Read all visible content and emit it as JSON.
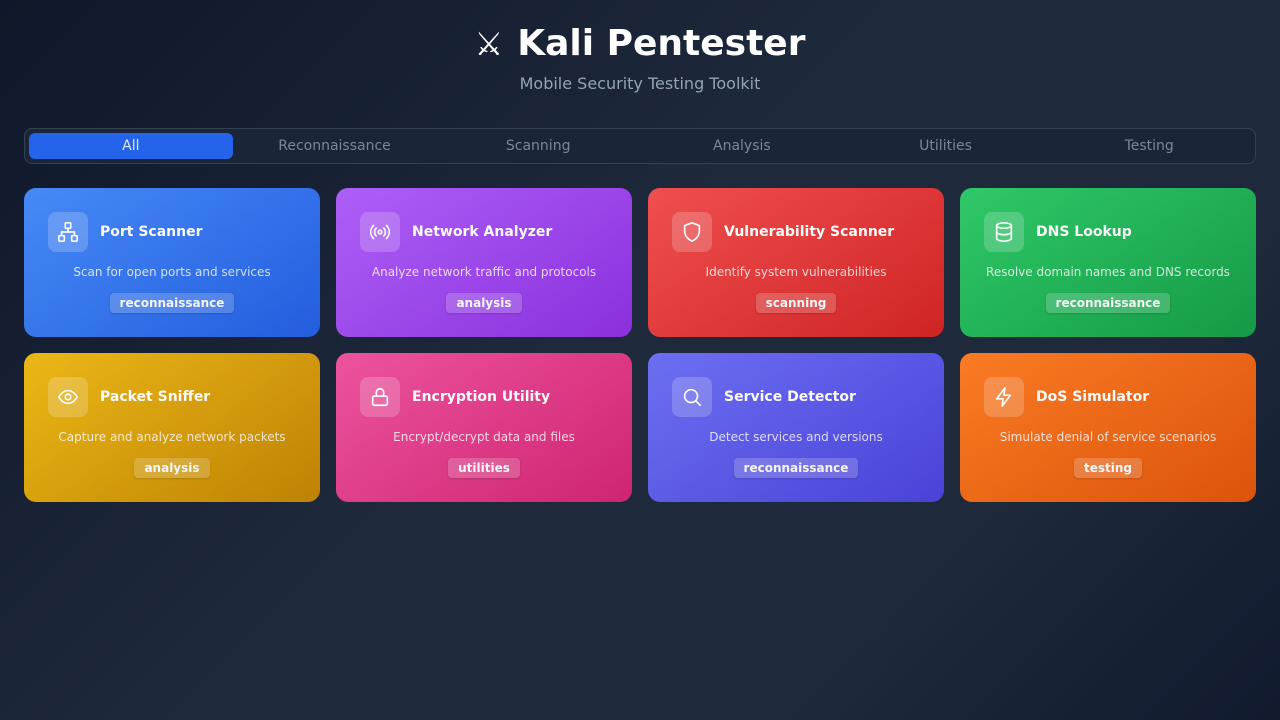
{
  "header": {
    "icon": "⚔",
    "title": "Kali Pentester",
    "subtitle": "Mobile Security Testing Toolkit"
  },
  "tabs": [
    {
      "label": "All",
      "active": true
    },
    {
      "label": "Reconnaissance",
      "active": false
    },
    {
      "label": "Scanning",
      "active": false
    },
    {
      "label": "Analysis",
      "active": false
    },
    {
      "label": "Utilities",
      "active": false
    },
    {
      "label": "Testing",
      "active": false
    }
  ],
  "colors": {
    "accent": "#2563eb",
    "blue": [
      "#3b82f6",
      "#2563eb"
    ],
    "purple": [
      "#a855f7",
      "#9333ea"
    ],
    "red": [
      "#ef4444",
      "#dc2626"
    ],
    "green": [
      "#22c55e",
      "#16a34a"
    ],
    "yellow": [
      "#eab308",
      "#ca8a04"
    ],
    "pink": [
      "#ec4899",
      "#db2777"
    ],
    "indigo": [
      "#6366f1",
      "#4f46e5"
    ],
    "orange": [
      "#f97316",
      "#ea580c"
    ]
  },
  "tools": [
    {
      "name": "Port Scanner",
      "description": "Scan for open ports and services",
      "category": "reconnaissance",
      "icon": "network-icon",
      "color": "blue"
    },
    {
      "name": "Network Analyzer",
      "description": "Analyze network traffic and protocols",
      "category": "analysis",
      "icon": "broadcast-icon",
      "color": "purple"
    },
    {
      "name": "Vulnerability Scanner",
      "description": "Identify system vulnerabilities",
      "category": "scanning",
      "icon": "shield-icon",
      "color": "red"
    },
    {
      "name": "DNS Lookup",
      "description": "Resolve domain names and DNS records",
      "category": "reconnaissance",
      "icon": "database-icon",
      "color": "green"
    },
    {
      "name": "Packet Sniffer",
      "description": "Capture and analyze network packets",
      "category": "analysis",
      "icon": "eye-icon",
      "color": "yellow"
    },
    {
      "name": "Encryption Utility",
      "description": "Encrypt/decrypt data and files",
      "category": "utilities",
      "icon": "lock-icon",
      "color": "pink"
    },
    {
      "name": "Service Detector",
      "description": "Detect services and versions",
      "category": "reconnaissance",
      "icon": "search-icon",
      "color": "indigo"
    },
    {
      "name": "DoS Simulator",
      "description": "Simulate denial of service scenarios",
      "category": "testing",
      "icon": "lightning-icon",
      "color": "orange"
    }
  ]
}
